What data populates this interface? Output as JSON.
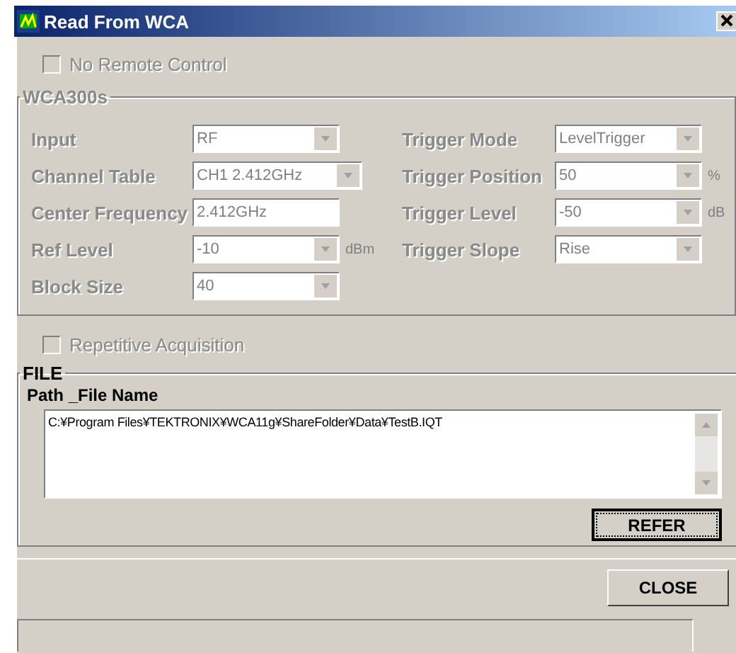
{
  "window": {
    "title": "Read From WCA"
  },
  "no_remote_control": {
    "label": "No Remote Control",
    "checked": false,
    "disabled": true
  },
  "wca_group": {
    "title": "WCA300s",
    "disabled": true,
    "left_fields": [
      {
        "label": "Input",
        "kind": "combo",
        "value": "RF",
        "wide": false
      },
      {
        "label": "Channel Table",
        "kind": "combo",
        "value": "CH1 2.412GHz",
        "wide": true
      },
      {
        "label": "Center Frequency",
        "kind": "text",
        "value": "2.412GHz",
        "wide": false
      },
      {
        "label": "Ref Level",
        "kind": "combo",
        "value": "-10",
        "unit": "dBm",
        "wide": false
      },
      {
        "label": "Block Size",
        "kind": "combo",
        "value": "40",
        "wide": false
      }
    ],
    "right_fields": [
      {
        "label": "Trigger Mode",
        "kind": "combo",
        "value": "LevelTrigger"
      },
      {
        "label": "Trigger Position",
        "kind": "combo",
        "value": "50",
        "unit": "%"
      },
      {
        "label": "Trigger Level",
        "kind": "combo",
        "value": "-50",
        "unit": "dB"
      },
      {
        "label": "Trigger Slope",
        "kind": "combo",
        "value": "Rise"
      }
    ]
  },
  "repetitive_acquisition": {
    "label": "Repetitive Acquisition",
    "checked": false,
    "disabled": true
  },
  "file_group": {
    "title": "FILE",
    "path_label": "Path _File Name",
    "path": "C:¥Program Files¥TEKTRONIX¥WCA11g¥ShareFolder¥Data¥TestB.IQT",
    "refer_button": "REFER"
  },
  "close_button": "CLOSE"
}
